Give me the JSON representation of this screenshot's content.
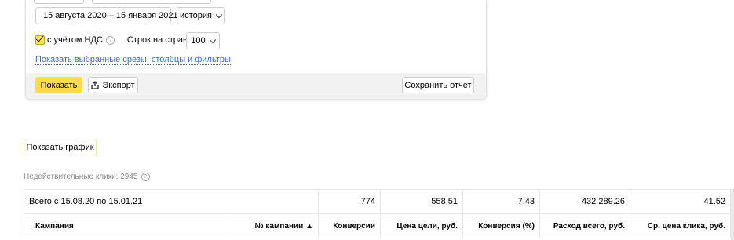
{
  "filters": {
    "date_range": "15 августа 2020 – 15 января 2021",
    "history_label": "история",
    "vat_label": "с учётом НДС",
    "rows_per_page_label": "Строк на странице",
    "rows_per_page_value": "100",
    "show_selected_link": "Показать выбранные срезы, столбцы и фильтры",
    "show_button": "Показать",
    "export_button": "Экспорт",
    "save_report_button": "Сохранить отчет"
  },
  "show_graph_button": "Показать график",
  "invalid_clicks": "Недействительные клики: 2945",
  "table": {
    "total_label": "Всего с 15.08.20 по 15.01.21",
    "totals": [
      "774",
      "558.51",
      "7.43",
      "432 289.26",
      "41.52"
    ],
    "headers": [
      "Кампания",
      "№ кампании ▲",
      "Конверсии",
      "Цена цели, руб.",
      "Конверсия (%)",
      "Расход всего, руб.",
      "Ср. цена клика, руб."
    ]
  }
}
